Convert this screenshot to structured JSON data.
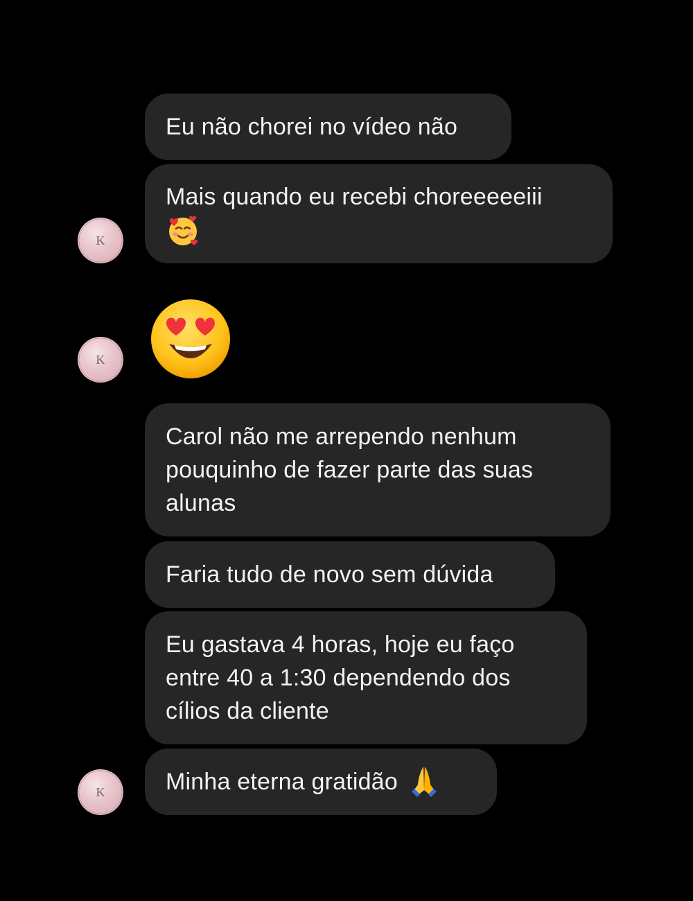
{
  "conversation": {
    "avatar_logo_text": "K",
    "messages": [
      {
        "text": "Eu não chorei no vídeo não"
      },
      {
        "text": "Mais quando eu recebi choreeeeeiii",
        "emoji": "smiling-face-with-hearts-icon"
      },
      {
        "emoji": "heart-eyes-icon"
      },
      {
        "lines": [
          "Carol não me arrependo nenhum",
          "pouquinho de fazer parte das suas",
          "alunas"
        ]
      },
      {
        "text": "Faria tudo de novo sem dúvida"
      },
      {
        "lines": [
          "Eu gastava 4 horas, hoje eu faço",
          "entre 40 a 1:30 dependendo dos",
          "cílios da cliente"
        ]
      },
      {
        "text": "Minha eterna gratidão",
        "emoji": "folded-hands-icon"
      }
    ]
  },
  "colors": {
    "background": "#000000",
    "bubble": "#262626",
    "text": "#f2f2f2",
    "avatar": "#e7c3ca"
  }
}
